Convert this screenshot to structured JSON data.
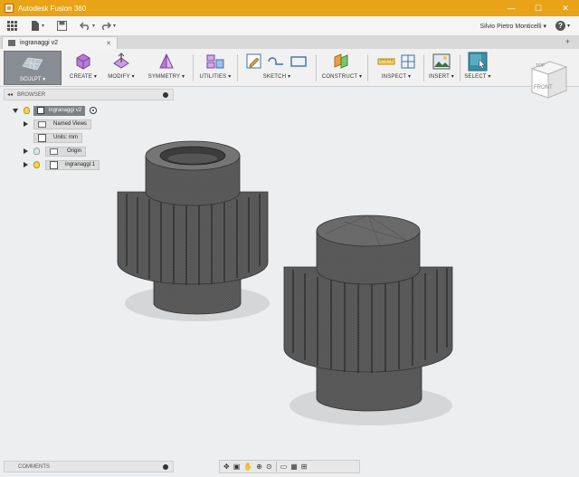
{
  "titlebar": {
    "title": "Autodesk Fusion 360",
    "minimize": "—",
    "maximize": "☐",
    "close": "✕"
  },
  "appbar": {
    "user": "Silvio Pietro Monticelli ▾",
    "help": "?",
    "help_caret": "▾"
  },
  "document_tab": {
    "label": "ingranaggi v2",
    "close": "✕",
    "new_tab": "+"
  },
  "toolbar": {
    "workspace": "SCULPT ▾",
    "groups": [
      {
        "label": "CREATE ▾"
      },
      {
        "label": "MODIFY ▾"
      },
      {
        "label": "SYMMETRY ▾"
      },
      {
        "label": "UTILITIES ▾"
      },
      {
        "label": "SKETCH ▾"
      },
      {
        "label": "CONSTRUCT ▾"
      },
      {
        "label": "INSPECT ▾"
      },
      {
        "label": "INSERT ▾"
      },
      {
        "label": "SELECT ▾"
      }
    ]
  },
  "browser": {
    "title": "BROWSER",
    "collapse": "◂◂",
    "root": "ingranaggi v2",
    "items": [
      {
        "label": "Named Views"
      },
      {
        "label": "Units: mm"
      },
      {
        "label": "Origin"
      },
      {
        "label": "ingranaggi:1"
      }
    ]
  },
  "viewcube": {
    "top": "TOP",
    "front": "FRONT"
  },
  "comments": {
    "title": "COMMENTS"
  },
  "navbar": {
    "orbit": "✥",
    "look": "▣",
    "pan": "✋",
    "zoom": "⊕",
    "fit": "⊙",
    "display": "▭",
    "grid": "▦",
    "viewports": "⊞"
  },
  "colors": {
    "title_bar": "#e8a318",
    "gear": "#5c5c5c",
    "active_workspace": "#888d93"
  }
}
